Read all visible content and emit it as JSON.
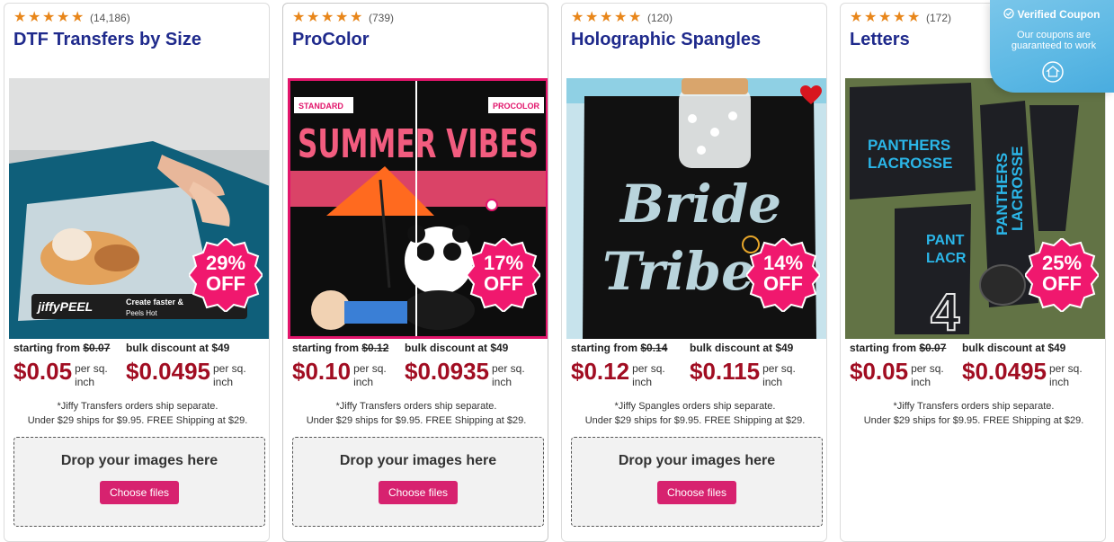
{
  "cards": [
    {
      "review_count": "(14,186)",
      "title": "DTF Transfers by Size",
      "image_overlay": {
        "brand": "jiffyPEEL",
        "tagline": "Create faster &",
        "sub": "Peels  Hot"
      },
      "discount": {
        "pct": "29%",
        "off": "OFF"
      },
      "starting_label": "starting from",
      "old_price": "$0.07",
      "bulk_label": "bulk discount at $49",
      "price": "$0.05",
      "bulk_price": "$0.0495",
      "unit_line1": "per sq.",
      "unit_line2": "inch",
      "note_line1": "*Jiffy Transfers orders ship separate.",
      "note_line2": "Under $29 ships for $9.95. FREE Shipping at $29.",
      "dropzone_text": "Drop your images here",
      "button_label": "Choose files"
    },
    {
      "review_count": "(739)",
      "title": "ProColor",
      "image_overlay": {
        "left_tag": "STANDARD",
        "right_tag": "PROCOLOR",
        "headline": "SUMMER VIBES"
      },
      "discount": {
        "pct": "17%",
        "off": "OFF"
      },
      "starting_label": "starting from",
      "old_price": "$0.12",
      "bulk_label": "bulk discount at $49",
      "price": "$0.10",
      "bulk_price": "$0.0935",
      "unit_line1": "per sq.",
      "unit_line2": "inch",
      "note_line1": "*Jiffy Transfers orders ship separate.",
      "note_line2": "Under $29 ships for $9.95. FREE Shipping at $29.",
      "dropzone_text": "Drop your images here",
      "button_label": "Choose files"
    },
    {
      "review_count": "(120)",
      "title": "Holographic Spangles",
      "image_overlay": {
        "line1": "Bride",
        "line2": "Tribe"
      },
      "discount": {
        "pct": "14%",
        "off": "OFF"
      },
      "starting_label": "starting from",
      "old_price": "$0.14",
      "bulk_label": "bulk discount at $49",
      "price": "$0.12",
      "bulk_price": "$0.115",
      "unit_line1": "per sq.",
      "unit_line2": "inch",
      "note_line1": "*Jiffy Spangles orders ship separate.",
      "note_line2": "Under $29 ships for $9.95. FREE Shipping at $29.",
      "dropzone_text": "Drop your images here",
      "button_label": "Choose files"
    },
    {
      "review_count": "(172)",
      "title": "Letters",
      "image_overlay": {
        "line1": "PANTHERS",
        "line2": "LACROSSE",
        "pants_a": "PANTHERS",
        "pants_b": "LACROSSE",
        "bag_a": "PANT",
        "bag_b": "LACR",
        "number": "4"
      },
      "discount": {
        "pct": "25%",
        "off": "OFF"
      },
      "starting_label": "starting from",
      "old_price": "$0.07",
      "bulk_label": "bulk discount at $49",
      "price": "$0.05",
      "bulk_price": "$0.0495",
      "unit_line1": "per sq.",
      "unit_line2": "inch",
      "note_line1": "*Jiffy Transfers orders ship separate.",
      "note_line2": "Under $29 ships for $9.95. FREE Shipping at $29.",
      "dropzone_text": "Drop your images here",
      "button_label": "Choose files"
    }
  ],
  "verified_coupon": {
    "title": "Verified Coupon",
    "subtitle": "Our coupons are guaranteed to work"
  },
  "colors": {
    "title": "#1f2a8c",
    "price": "#a10d22",
    "star": "#e8861a",
    "badge": "#f0186e",
    "button": "#d7226f"
  }
}
